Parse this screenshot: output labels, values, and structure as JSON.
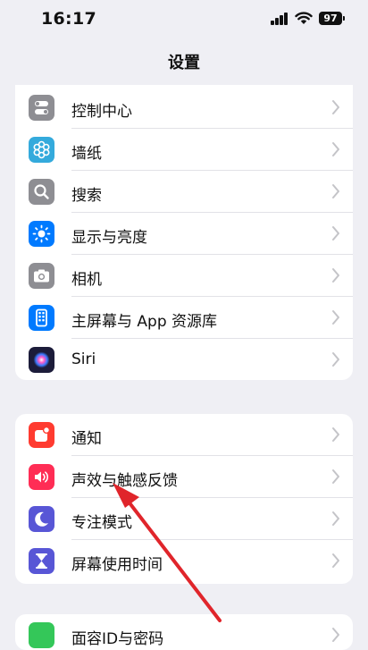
{
  "status_bar": {
    "time": "16:17",
    "battery": "97"
  },
  "header": {
    "title": "设置"
  },
  "groups": [
    {
      "items": [
        {
          "label": "控制中心",
          "icon": "control-center-icon",
          "color": "#8e8e93"
        },
        {
          "label": "墙纸",
          "icon": "wallpaper-icon",
          "color": "#34aadc"
        },
        {
          "label": "搜索",
          "icon": "search-icon",
          "color": "#8e8e93"
        },
        {
          "label": "显示与亮度",
          "icon": "brightness-icon",
          "color": "#007aff"
        },
        {
          "label": "相机",
          "icon": "camera-icon",
          "color": "#8e8e93"
        },
        {
          "label": "主屏幕与 App 资源库",
          "icon": "home-screen-icon",
          "color": "#007aff"
        },
        {
          "label": "Siri",
          "icon": "siri-icon",
          "color": "#1c1c3a"
        }
      ]
    },
    {
      "items": [
        {
          "label": "通知",
          "icon": "notifications-icon",
          "color": "#ff3b30"
        },
        {
          "label": "声效与触感反馈",
          "icon": "sounds-icon",
          "color": "#ff2d55"
        },
        {
          "label": "专注模式",
          "icon": "focus-moon-icon",
          "color": "#5856d6"
        },
        {
          "label": "屏幕使用时间",
          "icon": "screen-time-icon",
          "color": "#5856d6"
        }
      ]
    },
    {
      "items": [
        {
          "label": "面容ID与密码",
          "icon": "face-id-icon",
          "color": "#34c759"
        }
      ]
    }
  ],
  "annotation": {
    "color": "#e0252b",
    "points_to": "声效与触感反馈"
  }
}
